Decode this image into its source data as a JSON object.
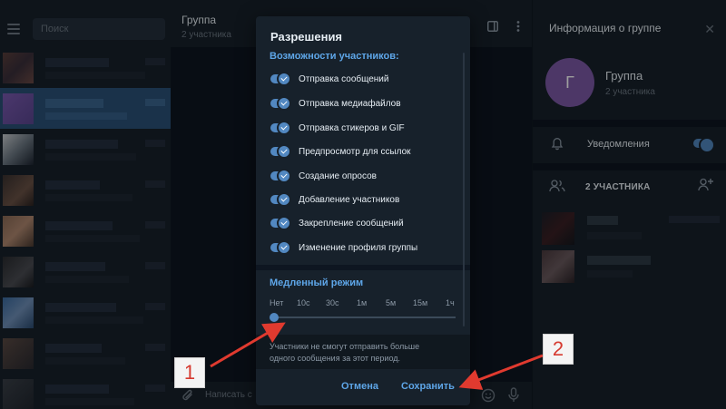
{
  "sidebar": {
    "search_placeholder": "Поиск"
  },
  "chat": {
    "title": "Группа",
    "subtitle": "2 участника",
    "composer_placeholder": "Написать с"
  },
  "info_panel": {
    "title": "Информация о группе",
    "avatar_letter": "Г",
    "group_name": "Группа",
    "group_subtitle": "2 участника",
    "notifications_label": "Уведомления",
    "members_label": "2 УЧАСТНИКА"
  },
  "dialog": {
    "title": "Разрешения",
    "section_title": "Возможности участников:",
    "permissions": [
      {
        "label": "Отправка сообщений",
        "enabled": true
      },
      {
        "label": "Отправка медиафайлов",
        "enabled": true
      },
      {
        "label": "Отправка стикеров и GIF",
        "enabled": true
      },
      {
        "label": "Предпросмотр для ссылок",
        "enabled": true
      },
      {
        "label": "Создание опросов",
        "enabled": true
      },
      {
        "label": "Добавление участников",
        "enabled": true
      },
      {
        "label": "Закрепление сообщений",
        "enabled": true
      },
      {
        "label": "Изменение профиля группы",
        "enabled": true
      }
    ],
    "slow_mode": {
      "title": "Медленный режим",
      "options": [
        "Нет",
        "10с",
        "30с",
        "1м",
        "5м",
        "15м",
        "1ч"
      ],
      "selected": "Нет",
      "note_line1": "Участники не смогут отправить больше",
      "note_line2": "одного сообщения за этот период."
    },
    "cancel_label": "Отмена",
    "save_label": "Сохранить"
  },
  "annotations": {
    "callout_1": "1",
    "callout_2": "2",
    "arrow_color": "#e03a2f"
  },
  "colors": {
    "accent": "#5288c1",
    "link": "#5ea6e8",
    "panel": "#17212b",
    "background": "#0e1621"
  }
}
